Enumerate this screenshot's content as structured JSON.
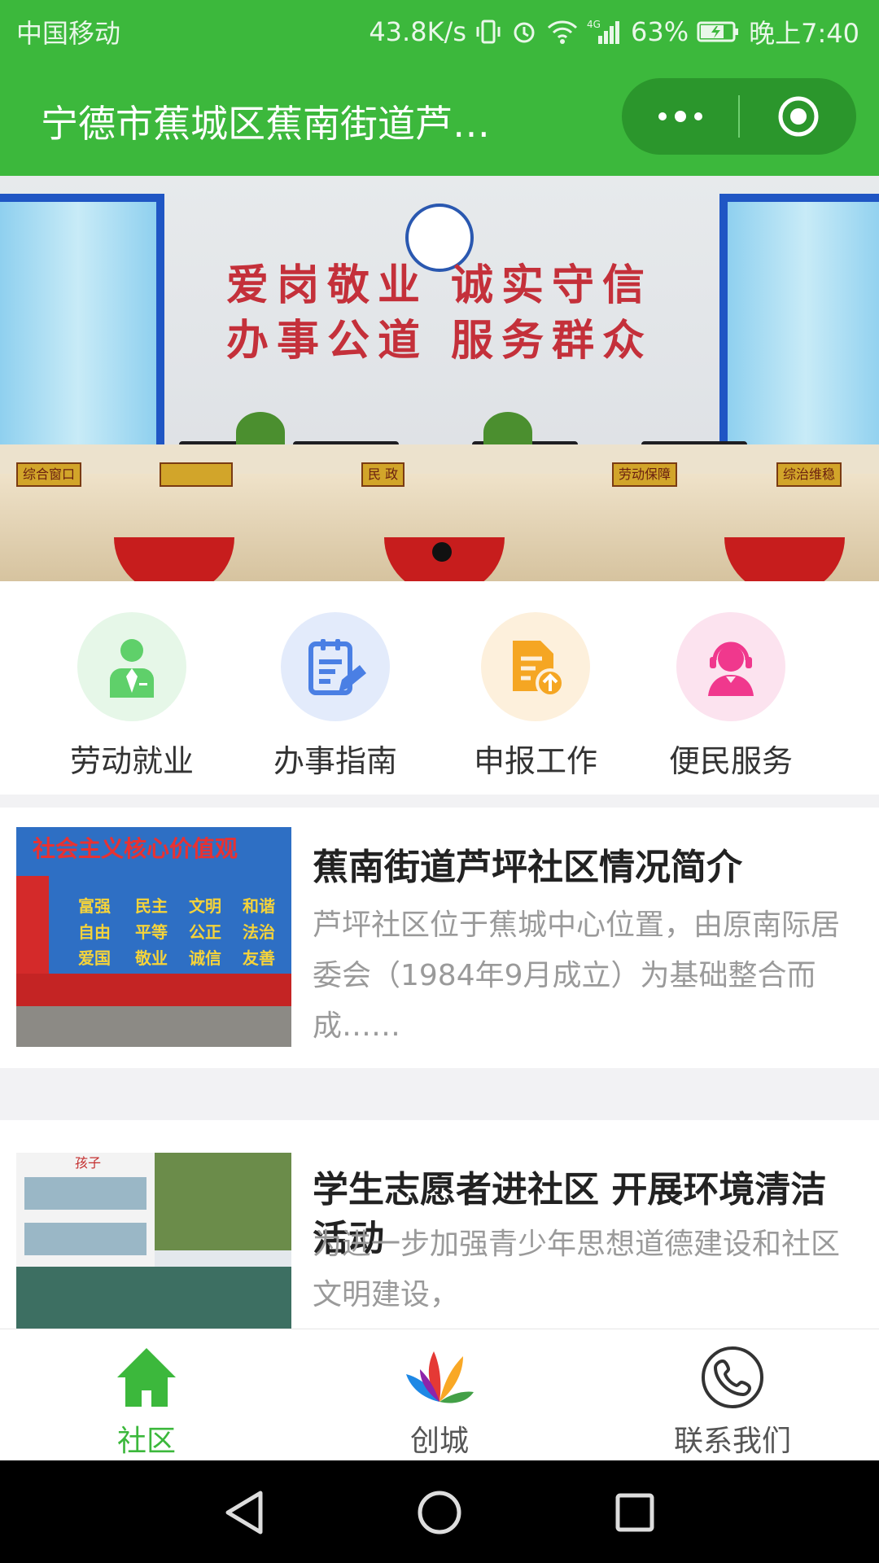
{
  "status_bar": {
    "carrier": "中国移动",
    "network_speed": "43.8K/s",
    "battery": "63%",
    "time": "晚上7:40"
  },
  "title_bar": {
    "title": "宁德市蕉城区蕉南街道芦…"
  },
  "banner": {
    "slogan_line1": "爱岗敬业 诚实守信",
    "slogan_line2": "办事公道 服务群众",
    "desk_plates": [
      "综合窗口",
      "",
      "民 政",
      "劳动保障",
      "综治维稳"
    ],
    "active_slide": 1,
    "total_slides": 1
  },
  "menu": {
    "items": [
      {
        "label": "劳动就业",
        "icon": "employment-person-icon",
        "color": "#5fd06a",
        "bg": "#e6f7e8"
      },
      {
        "label": "办事指南",
        "icon": "clipboard-guide-icon",
        "color": "#4a7fe4",
        "bg": "#e3ebfb"
      },
      {
        "label": "申报工作",
        "icon": "document-upload-icon",
        "color": "#f5a623",
        "bg": "#fdf0dc"
      },
      {
        "label": "便民服务",
        "icon": "customer-service-icon",
        "color": "#f0388d",
        "bg": "#fce3ef"
      }
    ]
  },
  "articles": [
    {
      "title": "蕉南街道芦坪社区情况简介",
      "excerpt": "芦坪社区位于蕉城中心位置，由原南际居委会（1984年9月成立）为基础整合而成……",
      "thumb_caption": "社会主义核心价值观",
      "thumb_words": [
        "富强",
        "民主",
        "文明",
        "和谐",
        "自由",
        "平等",
        "公正",
        "法治",
        "爱国",
        "敬业",
        "诚信",
        "友善"
      ]
    },
    {
      "title": "学生志愿者进社区 开展环境清洁活动",
      "excerpt": "为进一步加强青少年思想道德建设和社区文明建设，",
      "thumb_caption": "孩子"
    }
  ],
  "tabbar": {
    "active_color": "#3cb83c",
    "inactive_color": "#555555",
    "tabs": [
      {
        "label": "社区",
        "icon": "home-icon",
        "active": true
      },
      {
        "label": "创城",
        "icon": "colorful-petal-logo-icon",
        "active": false
      },
      {
        "label": "联系我们",
        "icon": "phone-icon",
        "active": false
      }
    ]
  }
}
